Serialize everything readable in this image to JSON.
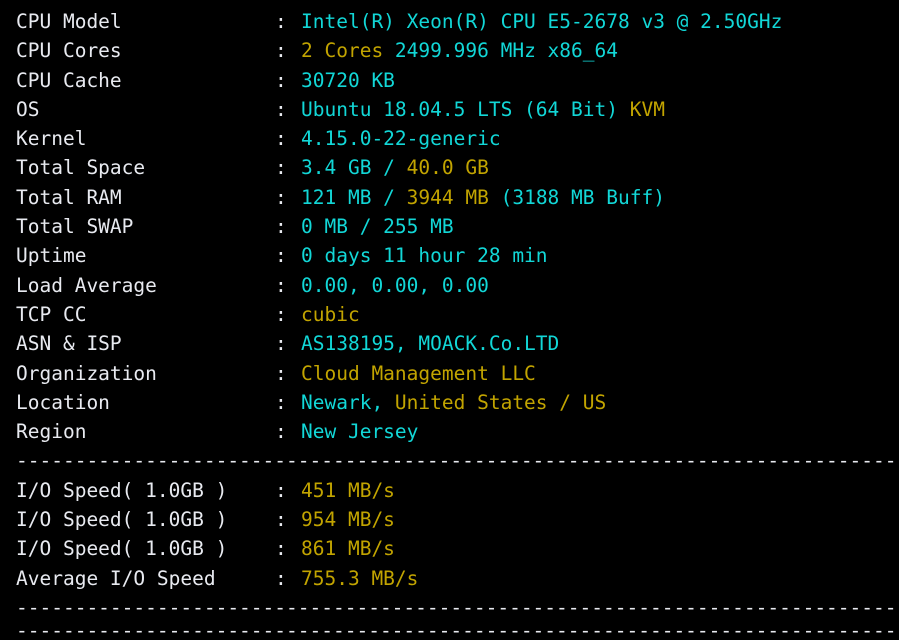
{
  "terminal": {
    "background_color": "#000000",
    "label_color": "#e8eaf0",
    "cyan_color": "#12d7d7",
    "yellow_color": "#c2a400",
    "separator": ":",
    "divider_line": "-------------------------------------------------------------------------------------",
    "system_info": {
      "rows": [
        {
          "label": "CPU Model",
          "value": "Intel(R) Xeon(R) CPU E5-2678 v3 @ 2.50GHz",
          "parts": [
            {
              "text": "Intel(R) Xeon(R) CPU E5-2678 v3 @ 2.50GHz",
              "color": "cyan"
            }
          ]
        },
        {
          "label": "CPU Cores",
          "value": "2 Cores 2499.996 MHz x86_64",
          "parts": [
            {
              "text": "2 Cores",
              "color": "yellow"
            },
            {
              "text": " 2499.996 MHz x86_64",
              "color": "cyan"
            }
          ]
        },
        {
          "label": "CPU Cache",
          "value": "30720 KB",
          "parts": [
            {
              "text": "30720 KB",
              "color": "cyan"
            }
          ]
        },
        {
          "label": "OS",
          "value": "Ubuntu 18.04.5 LTS (64 Bit) KVM",
          "parts": [
            {
              "text": "Ubuntu 18.04.5 LTS (64 Bit) ",
              "color": "cyan"
            },
            {
              "text": "KVM",
              "color": "yellow"
            }
          ]
        },
        {
          "label": "Kernel",
          "value": "4.15.0-22-generic",
          "parts": [
            {
              "text": "4.15.0-22-generic",
              "color": "cyan"
            }
          ]
        },
        {
          "label": "Total Space",
          "value": "3.4 GB / 40.0 GB",
          "parts": [
            {
              "text": "3.4 GB / ",
              "color": "cyan"
            },
            {
              "text": "40.0 GB",
              "color": "yellow"
            }
          ]
        },
        {
          "label": "Total RAM",
          "value": "121 MB / 3944 MB (3188 MB Buff)",
          "parts": [
            {
              "text": "121 MB / ",
              "color": "cyan"
            },
            {
              "text": "3944 MB",
              "color": "yellow"
            },
            {
              "text": " (3188 MB Buff)",
              "color": "cyan"
            }
          ]
        },
        {
          "label": "Total SWAP",
          "value": "0 MB / 255 MB",
          "parts": [
            {
              "text": "0 MB / 255 MB",
              "color": "cyan"
            }
          ]
        },
        {
          "label": "Uptime",
          "value": "0 days 11 hour 28 min",
          "parts": [
            {
              "text": "0 days 11 hour 28 min",
              "color": "cyan"
            }
          ]
        },
        {
          "label": "Load Average",
          "value": "0.00, 0.00, 0.00",
          "parts": [
            {
              "text": "0.00, 0.00, 0.00",
              "color": "cyan"
            }
          ]
        },
        {
          "label": "TCP CC",
          "value": "cubic",
          "parts": [
            {
              "text": "cubic",
              "color": "yellow"
            }
          ]
        },
        {
          "label": "ASN & ISP",
          "value": "AS138195, MOACK.Co.LTD",
          "parts": [
            {
              "text": "AS138195, MOACK.Co.LTD",
              "color": "cyan"
            }
          ]
        },
        {
          "label": "Organization",
          "value": "Cloud Management LLC",
          "parts": [
            {
              "text": "Cloud Management LLC",
              "color": "yellow"
            }
          ]
        },
        {
          "label": "Location",
          "value": "Newark, United States / US",
          "parts": [
            {
              "text": "Newark, ",
              "color": "cyan"
            },
            {
              "text": "United States / US",
              "color": "yellow"
            }
          ]
        },
        {
          "label": "Region",
          "value": "New Jersey",
          "parts": [
            {
              "text": "New Jersey",
              "color": "cyan"
            }
          ]
        }
      ]
    },
    "io_test": {
      "rows": [
        {
          "label": "I/O Speed( 1.0GB )",
          "value": "451 MB/s",
          "parts": [
            {
              "text": "451 MB/s",
              "color": "yellow"
            }
          ]
        },
        {
          "label": "I/O Speed( 1.0GB )",
          "value": "954 MB/s",
          "parts": [
            {
              "text": "954 MB/s",
              "color": "yellow"
            }
          ]
        },
        {
          "label": "I/O Speed( 1.0GB )",
          "value": "861 MB/s",
          "parts": [
            {
              "text": "861 MB/s",
              "color": "yellow"
            }
          ]
        },
        {
          "label": "Average I/O Speed",
          "value": "755.3 MB/s",
          "parts": [
            {
              "text": "755.3 MB/s",
              "color": "yellow"
            }
          ]
        }
      ]
    }
  }
}
